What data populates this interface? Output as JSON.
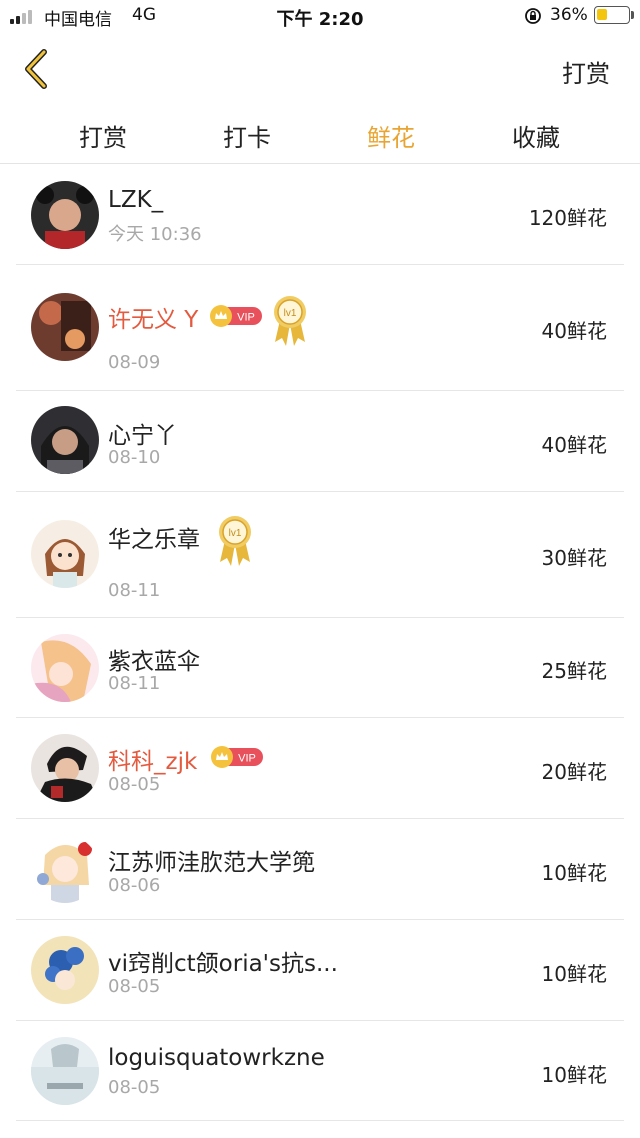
{
  "status_bar": {
    "carrier": "中国电信",
    "network": "4G",
    "time": "下午 2:20",
    "battery_pct": "36%",
    "battery_level": 0.36
  },
  "nav": {
    "action": "打赏"
  },
  "tabs": [
    {
      "label": "打赏",
      "active": false
    },
    {
      "label": "打卡",
      "active": false
    },
    {
      "label": "鲜花",
      "active": true
    },
    {
      "label": "收藏",
      "active": false
    }
  ],
  "colors": {
    "accent": "#e9a534",
    "vip_name": "#e45a3f",
    "vip_badge": "#e8505b",
    "medal": "#e7b73c",
    "date": "#a8a8a8"
  },
  "badges": {
    "vip": "VIP",
    "level": "lv1"
  },
  "items": [
    {
      "name": "LZK_",
      "date": "今天 10:36",
      "amount": "120鲜花",
      "vip": false,
      "level": false
    },
    {
      "name": "许无义 Y",
      "date": "08-09",
      "amount": "40鲜花",
      "vip": true,
      "level": true
    },
    {
      "name": "心宁丫",
      "date": "08-10",
      "amount": "40鲜花",
      "vip": false,
      "level": false
    },
    {
      "name": "华之乐章",
      "date": "08-11",
      "amount": "30鲜花",
      "vip": false,
      "level": true
    },
    {
      "name": "紫衣蓝伞",
      "date": "08-11",
      "amount": "25鲜花",
      "vip": false,
      "level": false
    },
    {
      "name": "科科_zjk",
      "date": "08-05",
      "amount": "20鲜花",
      "vip": true,
      "level": false
    },
    {
      "name": "江苏师洼肷范大学篼",
      "date": "08-06",
      "amount": "10鲜花",
      "vip": false,
      "level": false
    },
    {
      "name": "vi窍削ct颌oria's抗s...",
      "date": "08-05",
      "amount": "10鲜花",
      "vip": false,
      "level": false
    },
    {
      "name": "loguisquatowrkzne",
      "date": "08-05",
      "amount": "10鲜花",
      "vip": false,
      "level": false
    }
  ]
}
